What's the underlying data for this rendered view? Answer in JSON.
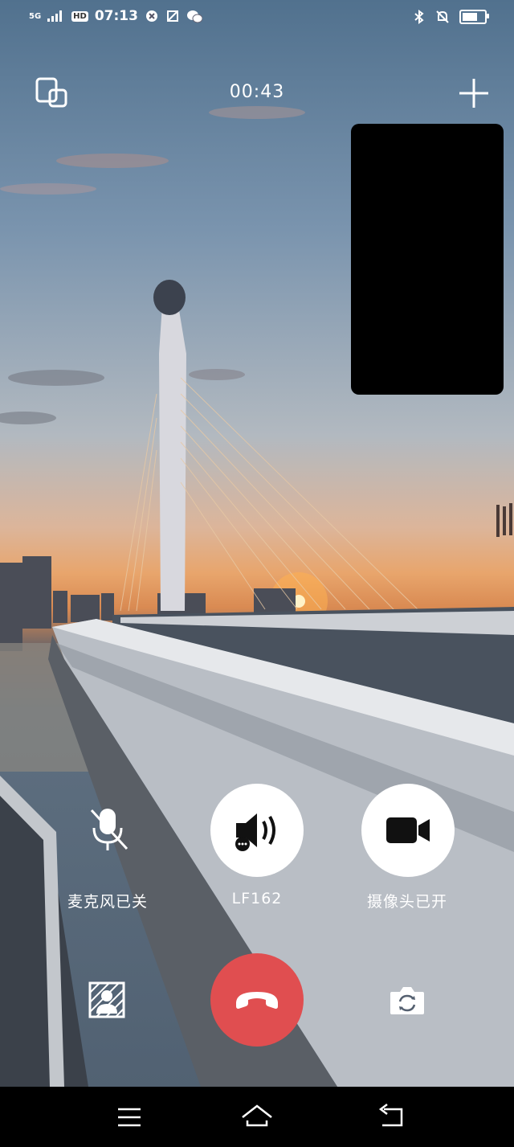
{
  "status_bar": {
    "network": "5G",
    "hd_badge": "HD",
    "time": "07:13"
  },
  "call": {
    "duration": "00:43"
  },
  "controls": {
    "mic_label": "麦克风已关",
    "speaker_label": "LF162",
    "camera_label": "摄像头已开"
  },
  "colors": {
    "hangup": "#e04e50",
    "control_bg": "#ffffff",
    "nav_bar": "#000000"
  },
  "icons": [
    "switch-window-icon",
    "add-icon",
    "mic-off-icon",
    "speaker-icon",
    "video-camera-icon",
    "background-blur-icon",
    "hang-up-icon",
    "flip-camera-icon",
    "menu-icon",
    "home-icon",
    "back-icon"
  ]
}
